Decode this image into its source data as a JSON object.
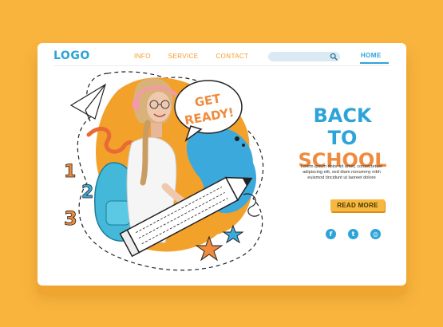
{
  "header": {
    "logo": "LOGO",
    "nav": [
      "INFO",
      "SERVICE",
      "CONTACT"
    ],
    "search_placeholder": "",
    "home_tab": "HOME"
  },
  "hero": {
    "bubble_line1": "GET",
    "bubble_line2": "READY!",
    "numbers": [
      "1",
      "2",
      "3"
    ]
  },
  "content": {
    "title_line1": "BACK TO",
    "title_line2": "SCHOOL",
    "body_lines": [
      "Lorem ipsum dolor sit amet, consectetuer",
      "adipiscing elit, sed diam nonummy nibh",
      "euismod tincidunt ut laoreet dolore"
    ],
    "read_more": "READ MORE"
  },
  "social": {
    "facebook": "f",
    "twitter": "t",
    "instagram": "◎"
  },
  "colors": {
    "background": "#f9b43d",
    "blue": "#2da4d9",
    "orange": "#f08a3c",
    "button": "#f6b83f"
  }
}
